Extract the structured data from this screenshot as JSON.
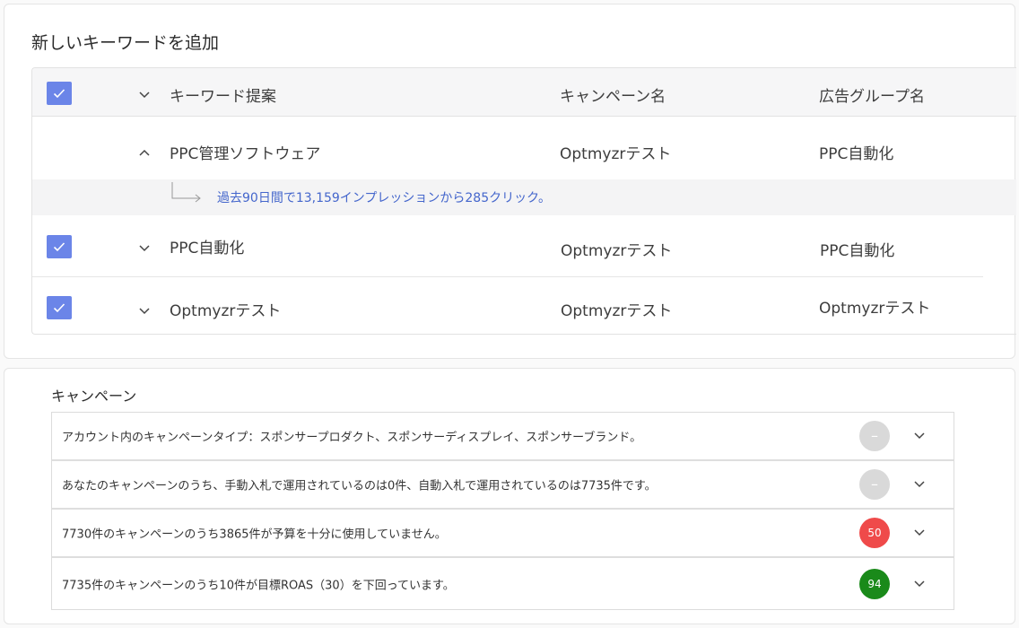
{
  "keywords_card": {
    "title": "新しいキーワードを追加",
    "columns": {
      "keyword": "キーワード提案",
      "campaign": "キャンペーン名",
      "ad_group": "広告グループ名"
    },
    "rows": [
      {
        "keyword": "PPC管理ソフトウェア",
        "campaign": "Optmyzrテスト",
        "ad_group": "PPC自動化",
        "checked": false,
        "expanded": true,
        "detail": "過去90日間で13,159インプレッションから285クリック。"
      },
      {
        "keyword": "PPC自動化",
        "campaign": "Optmyzrテスト",
        "ad_group": "PPC自動化",
        "checked": true,
        "expanded": false
      },
      {
        "keyword": "Optmyzrテスト",
        "campaign": "Optmyzrテスト",
        "ad_group": "Optmyzrテスト",
        "checked": true,
        "expanded": false
      }
    ],
    "checkbox_color": "#6b85e8",
    "detail_text_color": "#4466cc"
  },
  "campaigns_card": {
    "title": "キャンペーン",
    "items": [
      {
        "text": "アカウント内のキャンペーンタイプ：スポンサープロダクト、スポンサーディスプレイ、スポンサーブランド。",
        "score": "–",
        "score_color": "#d9d9d9"
      },
      {
        "text": "あなたのキャンペーンのうち、手動入札で運用されているのは0件、自動入札で運用されているのは7735件です。",
        "score": "–",
        "score_color": "#d9d9d9"
      },
      {
        "text": "7730件のキャンペーンのうち3865件が予算を十分に使用していません。",
        "score": "50",
        "score_color": "#ef4a4a"
      },
      {
        "text": "7735件のキャンペーンのうち10件が目標ROAS（30）を下回っています。",
        "score": "94",
        "score_color": "#1a8a1a"
      }
    ]
  }
}
